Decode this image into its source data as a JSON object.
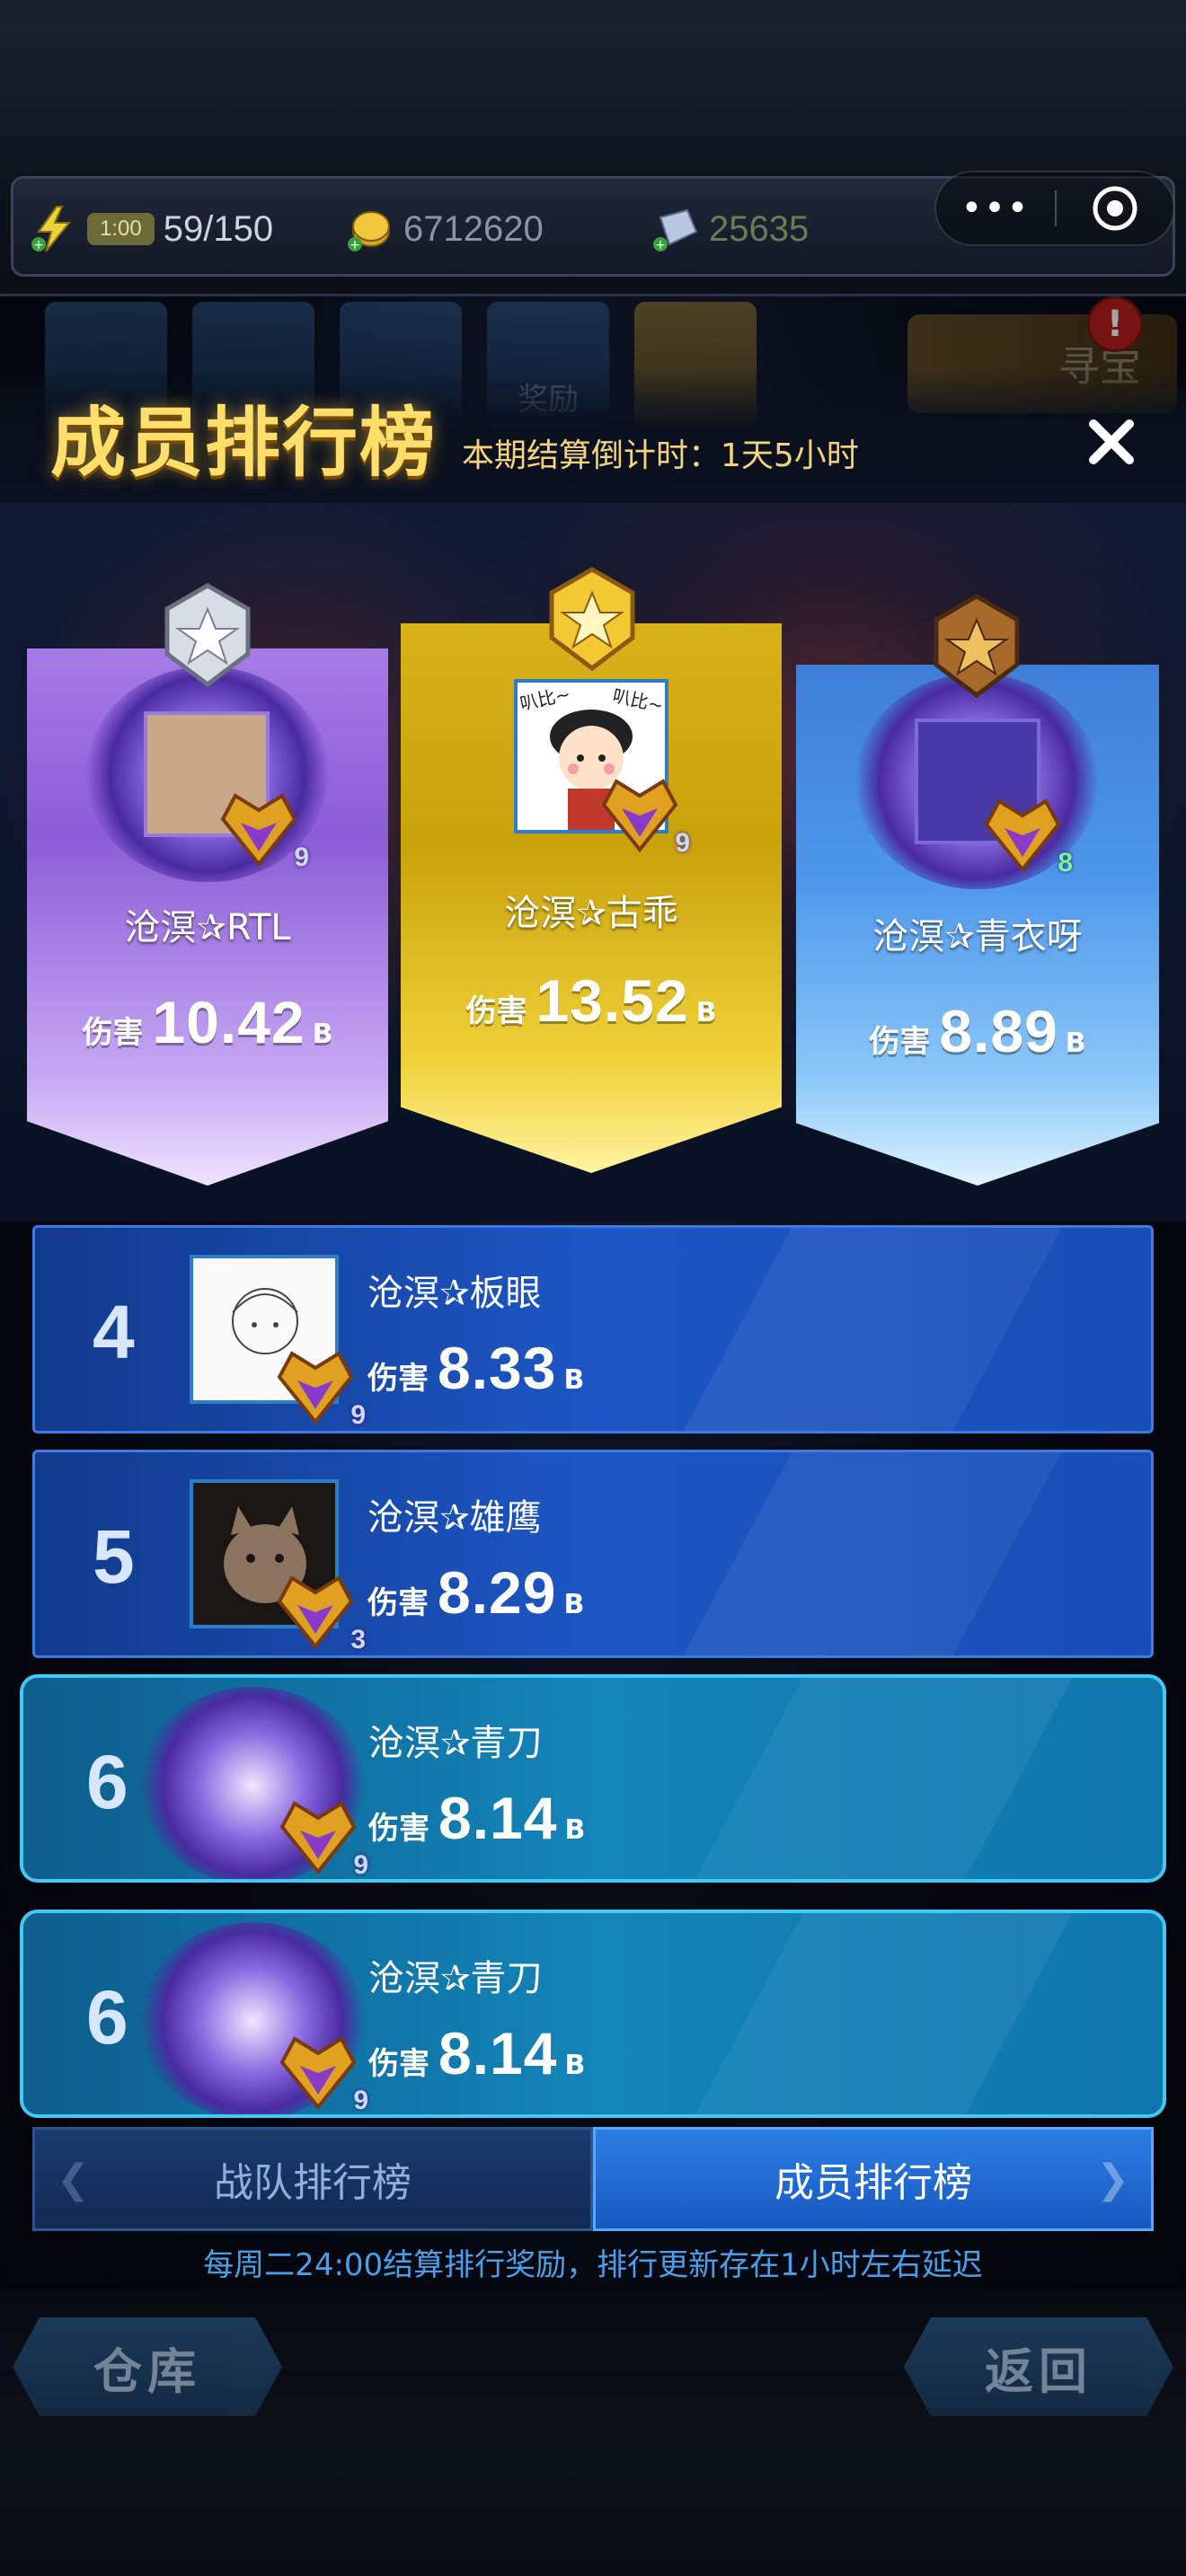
{
  "resources": {
    "energy_timer": "1:00",
    "energy": "59/150",
    "gold": "6712620",
    "crystal": "25635"
  },
  "mini_program": {
    "more_icon": "more-dots-icon",
    "close_icon": "target-close-icon"
  },
  "top_icons": [
    {
      "label": ""
    },
    {
      "label": ""
    },
    {
      "label": ""
    },
    {
      "label": "奖励"
    },
    {
      "label": ""
    }
  ],
  "treasure_label": "寻宝",
  "notification_badge": "!",
  "dialog": {
    "title": "成员排行榜",
    "countdown": "本期结算倒计时：1天5小时",
    "close_icon": "close-icon"
  },
  "podium": [
    {
      "position": "left",
      "rank": 2,
      "name": "沧溟✰RTL",
      "damage_label": "伤害",
      "damage": "10.42",
      "unit": "B",
      "level": "9"
    },
    {
      "position": "center",
      "rank": 1,
      "name": "沧溟✰古乖",
      "damage_label": "伤害",
      "damage": "13.52",
      "unit": "B",
      "level": "9",
      "avatar_text_left": "叭比~",
      "avatar_text_right": "叭比~"
    },
    {
      "position": "right",
      "rank": 3,
      "name": "沧溟✰青衣呀",
      "damage_label": "伤害",
      "damage": "8.89",
      "unit": "B",
      "level": "8"
    }
  ],
  "list": [
    {
      "rank": "4",
      "name": "沧溟✰板眼",
      "damage_label": "伤害",
      "damage": "8.33",
      "unit": "B",
      "level": "9",
      "style": "blue"
    },
    {
      "rank": "5",
      "name": "沧溟✰雄鹰",
      "damage_label": "伤害",
      "damage": "8.29",
      "unit": "B",
      "level": "3",
      "style": "blue"
    },
    {
      "rank": "6",
      "name": "沧溟✰青刀",
      "damage_label": "伤害",
      "damage": "8.14",
      "unit": "B",
      "level": "9",
      "style": "teal"
    },
    {
      "rank": "6",
      "name": "沧溟✰青刀",
      "damage_label": "伤害",
      "damage": "8.14",
      "unit": "B",
      "level": "9",
      "style": "teal"
    }
  ],
  "tabs": [
    {
      "label": "战队排行榜",
      "active": false
    },
    {
      "label": "成员排行榜",
      "active": true
    }
  ],
  "footnote": "每周二24:00结算排行奖励，排行更新存在1小时左右延迟",
  "bottom_buttons": {
    "left": "仓库",
    "right": "返回"
  },
  "colors": {
    "title_gold": "#ffdf6a",
    "row_blue": "#1d56c4",
    "row_teal": "#1384b8",
    "footnote": "#4aa0e8"
  }
}
